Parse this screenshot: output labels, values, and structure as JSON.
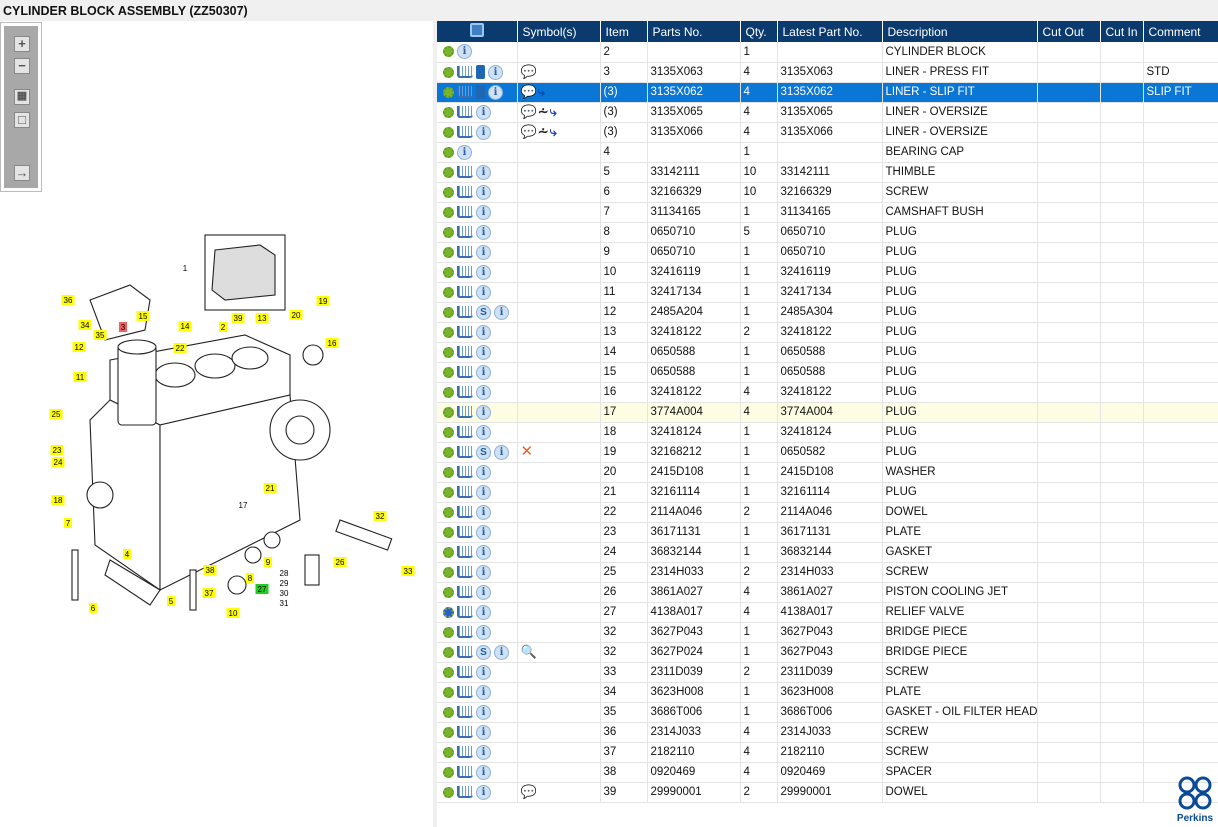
{
  "title": "CYLINDER BLOCK ASSEMBLY (ZZ50307)",
  "toolbar": {
    "zoom_in": "+",
    "zoom_out": "−",
    "fit": "▦",
    "reset": "□",
    "export": "→"
  },
  "diagram": {
    "callouts": [
      "1",
      "2",
      "3",
      "4",
      "5",
      "6",
      "7",
      "8",
      "9",
      "10",
      "11",
      "12",
      "13",
      "14",
      "15",
      "16",
      "17",
      "18",
      "19",
      "20",
      "21",
      "22",
      "23",
      "24",
      "25",
      "26",
      "27",
      "28",
      "29",
      "30",
      "31",
      "32",
      "33",
      "34",
      "35",
      "36",
      "37",
      "38",
      "39"
    ]
  },
  "table": {
    "headers": [
      "",
      "Symbol(s)",
      "Item",
      "Parts No.",
      "Qty.",
      "Latest Part No.",
      "Description",
      "Cut Out",
      "Cut In",
      "Comment"
    ],
    "rows": [
      {
        "icons": "gear,info",
        "symbols": "",
        "item": "2",
        "part": "",
        "qty": "1",
        "latest": "",
        "desc": "CYLINDER BLOCK",
        "cutout": "",
        "cutin": "",
        "comment": ""
      },
      {
        "icons": "gear,cart,book,info",
        "symbols": "note",
        "item": "3",
        "part": "3135X063",
        "qty": "4",
        "latest": "3135X063",
        "desc": "LINER - PRESS FIT",
        "cutout": "",
        "cutin": "",
        "comment": "STD"
      },
      {
        "icons": "gear,cart,book,info",
        "symbols": "note,arrow",
        "item": "(3)",
        "part": "3135X062",
        "qty": "4",
        "latest": "3135X062",
        "desc": "LINER - SLIP FIT",
        "cutout": "",
        "cutin": "",
        "comment": "SLIP FIT",
        "selected": true
      },
      {
        "icons": "gear,cart,info",
        "symbols": "note,compress,arrow",
        "item": "(3)",
        "part": "3135X065",
        "qty": "4",
        "latest": "3135X065",
        "desc": "LINER - OVERSIZE",
        "cutout": "",
        "cutin": "",
        "comment": ""
      },
      {
        "icons": "gear,cart,info",
        "symbols": "note,compress,arrow",
        "item": "(3)",
        "part": "3135X066",
        "qty": "4",
        "latest": "3135X066",
        "desc": "LINER - OVERSIZE",
        "cutout": "",
        "cutin": "",
        "comment": ""
      },
      {
        "icons": "gear,info",
        "symbols": "",
        "item": "4",
        "part": "",
        "qty": "1",
        "latest": "",
        "desc": "BEARING CAP",
        "cutout": "",
        "cutin": "",
        "comment": ""
      },
      {
        "icons": "gear,cart,info",
        "symbols": "",
        "item": "5",
        "part": "33142111",
        "qty": "10",
        "latest": "33142111",
        "desc": "THIMBLE",
        "cutout": "",
        "cutin": "",
        "comment": ""
      },
      {
        "icons": "gear,cart,info",
        "symbols": "",
        "item": "6",
        "part": "32166329",
        "qty": "10",
        "latest": "32166329",
        "desc": "SCREW",
        "cutout": "",
        "cutin": "",
        "comment": ""
      },
      {
        "icons": "gear,cart,info",
        "symbols": "",
        "item": "7",
        "part": "31134165",
        "qty": "1",
        "latest": "31134165",
        "desc": "CAMSHAFT BUSH",
        "cutout": "",
        "cutin": "",
        "comment": ""
      },
      {
        "icons": "gear,cart,info",
        "symbols": "",
        "item": "8",
        "part": "0650710",
        "qty": "5",
        "latest": "0650710",
        "desc": "PLUG",
        "cutout": "",
        "cutin": "",
        "comment": ""
      },
      {
        "icons": "gear,cart,info",
        "symbols": "",
        "item": "9",
        "part": "0650710",
        "qty": "1",
        "latest": "0650710",
        "desc": "PLUG",
        "cutout": "",
        "cutin": "",
        "comment": ""
      },
      {
        "icons": "gear,cart,info",
        "symbols": "",
        "item": "10",
        "part": "32416119",
        "qty": "1",
        "latest": "32416119",
        "desc": "PLUG",
        "cutout": "",
        "cutin": "",
        "comment": ""
      },
      {
        "icons": "gear,cart,info",
        "symbols": "",
        "item": "11",
        "part": "32417134",
        "qty": "1",
        "latest": "32417134",
        "desc": "PLUG",
        "cutout": "",
        "cutin": "",
        "comment": ""
      },
      {
        "icons": "gear,cart,s,info",
        "symbols": "",
        "item": "12",
        "part": "2485A204",
        "qty": "1",
        "latest": "2485A304",
        "desc": "PLUG",
        "cutout": "",
        "cutin": "",
        "comment": ""
      },
      {
        "icons": "gear,cart,info",
        "symbols": "",
        "item": "13",
        "part": "32418122",
        "qty": "2",
        "latest": "32418122",
        "desc": "PLUG",
        "cutout": "",
        "cutin": "",
        "comment": ""
      },
      {
        "icons": "gear,cart,info",
        "symbols": "",
        "item": "14",
        "part": "0650588",
        "qty": "1",
        "latest": "0650588",
        "desc": "PLUG",
        "cutout": "",
        "cutin": "",
        "comment": ""
      },
      {
        "icons": "gear,cart,info",
        "symbols": "",
        "item": "15",
        "part": "0650588",
        "qty": "1",
        "latest": "0650588",
        "desc": "PLUG",
        "cutout": "",
        "cutin": "",
        "comment": ""
      },
      {
        "icons": "gear,cart,info",
        "symbols": "",
        "item": "16",
        "part": "32418122",
        "qty": "4",
        "latest": "32418122",
        "desc": "PLUG",
        "cutout": "",
        "cutin": "",
        "comment": ""
      },
      {
        "icons": "gear,cart,info",
        "symbols": "",
        "item": "17",
        "part": "3774A004",
        "qty": "4",
        "latest": "3774A004",
        "desc": "PLUG",
        "cutout": "",
        "cutin": "",
        "comment": "",
        "highlight": true
      },
      {
        "icons": "gear,cart,info",
        "symbols": "",
        "item": "18",
        "part": "32418124",
        "qty": "1",
        "latest": "32418124",
        "desc": "PLUG",
        "cutout": "",
        "cutin": "",
        "comment": ""
      },
      {
        "icons": "gear,cart,s,info",
        "symbols": "x",
        "item": "19",
        "part": "32168212",
        "qty": "1",
        "latest": "0650582",
        "desc": "PLUG",
        "cutout": "",
        "cutin": "",
        "comment": ""
      },
      {
        "icons": "gear,cart,info",
        "symbols": "",
        "item": "20",
        "part": "2415D108",
        "qty": "1",
        "latest": "2415D108",
        "desc": "WASHER",
        "cutout": "",
        "cutin": "",
        "comment": ""
      },
      {
        "icons": "gear,cart,info",
        "symbols": "",
        "item": "21",
        "part": "32161114",
        "qty": "1",
        "latest": "32161114",
        "desc": "PLUG",
        "cutout": "",
        "cutin": "",
        "comment": ""
      },
      {
        "icons": "gear,cart,info",
        "symbols": "",
        "item": "22",
        "part": "2114A046",
        "qty": "2",
        "latest": "2114A046",
        "desc": "DOWEL",
        "cutout": "",
        "cutin": "",
        "comment": ""
      },
      {
        "icons": "gear,cart,info",
        "symbols": "",
        "item": "23",
        "part": "36171131",
        "qty": "1",
        "latest": "36171131",
        "desc": "PLATE",
        "cutout": "",
        "cutin": "",
        "comment": ""
      },
      {
        "icons": "gear,cart,info",
        "symbols": "",
        "item": "24",
        "part": "36832144",
        "qty": "1",
        "latest": "36832144",
        "desc": "GASKET",
        "cutout": "",
        "cutin": "",
        "comment": ""
      },
      {
        "icons": "gear,cart,info",
        "symbols": "",
        "item": "25",
        "part": "2314H033",
        "qty": "2",
        "latest": "2314H033",
        "desc": "SCREW",
        "cutout": "",
        "cutin": "",
        "comment": ""
      },
      {
        "icons": "gear,cart,info",
        "symbols": "",
        "item": "26",
        "part": "3861A027",
        "qty": "4",
        "latest": "3861A027",
        "desc": "PISTON COOLING JET",
        "cutout": "",
        "cutin": "",
        "comment": ""
      },
      {
        "icons": "gears,cart,info",
        "symbols": "",
        "item": "27",
        "part": "4138A017",
        "qty": "4",
        "latest": "4138A017",
        "desc": "RELIEF VALVE",
        "cutout": "",
        "cutin": "",
        "comment": ""
      },
      {
        "icons": "gear,cart,info",
        "symbols": "",
        "item": "32",
        "part": "3627P043",
        "qty": "1",
        "latest": "3627P043",
        "desc": "BRIDGE PIECE",
        "cutout": "",
        "cutin": "",
        "comment": ""
      },
      {
        "icons": "gear,cart,s,info",
        "symbols": "booksearch",
        "item": "32",
        "part": "3627P024",
        "qty": "1",
        "latest": "3627P043",
        "desc": "BRIDGE PIECE",
        "cutout": "",
        "cutin": "",
        "comment": ""
      },
      {
        "icons": "gear,cart,info",
        "symbols": "",
        "item": "33",
        "part": "2311D039",
        "qty": "2",
        "latest": "2311D039",
        "desc": "SCREW",
        "cutout": "",
        "cutin": "",
        "comment": ""
      },
      {
        "icons": "gear,cart,info",
        "symbols": "",
        "item": "34",
        "part": "3623H008",
        "qty": "1",
        "latest": "3623H008",
        "desc": "PLATE",
        "cutout": "",
        "cutin": "",
        "comment": ""
      },
      {
        "icons": "gear,cart,info",
        "symbols": "",
        "item": "35",
        "part": "3686T006",
        "qty": "1",
        "latest": "3686T006",
        "desc": "GASKET - OIL FILTER HEAD",
        "cutout": "",
        "cutin": "",
        "comment": ""
      },
      {
        "icons": "gear,cart,info",
        "symbols": "",
        "item": "36",
        "part": "2314J033",
        "qty": "4",
        "latest": "2314J033",
        "desc": "SCREW",
        "cutout": "",
        "cutin": "",
        "comment": ""
      },
      {
        "icons": "gear,cart,info",
        "symbols": "",
        "item": "37",
        "part": "2182110",
        "qty": "4",
        "latest": "2182110",
        "desc": "SCREW",
        "cutout": "",
        "cutin": "",
        "comment": ""
      },
      {
        "icons": "gear,cart,info",
        "symbols": "",
        "item": "38",
        "part": "0920469",
        "qty": "4",
        "latest": "0920469",
        "desc": "SPACER",
        "cutout": "",
        "cutin": "",
        "comment": ""
      },
      {
        "icons": "gear,cart,info",
        "symbols": "note",
        "item": "39",
        "part": "29990001",
        "qty": "2",
        "latest": "29990001",
        "desc": "DOWEL",
        "cutout": "",
        "cutin": "",
        "comment": ""
      }
    ]
  },
  "logo": {
    "text": "Perkins"
  },
  "colors": {
    "header": "#0b3a6e",
    "selected": "#0a77d6",
    "highlight": "#fdfde3",
    "callout": "#ffff00",
    "callout_red": "#f06060",
    "callout_green": "#22cc22"
  }
}
